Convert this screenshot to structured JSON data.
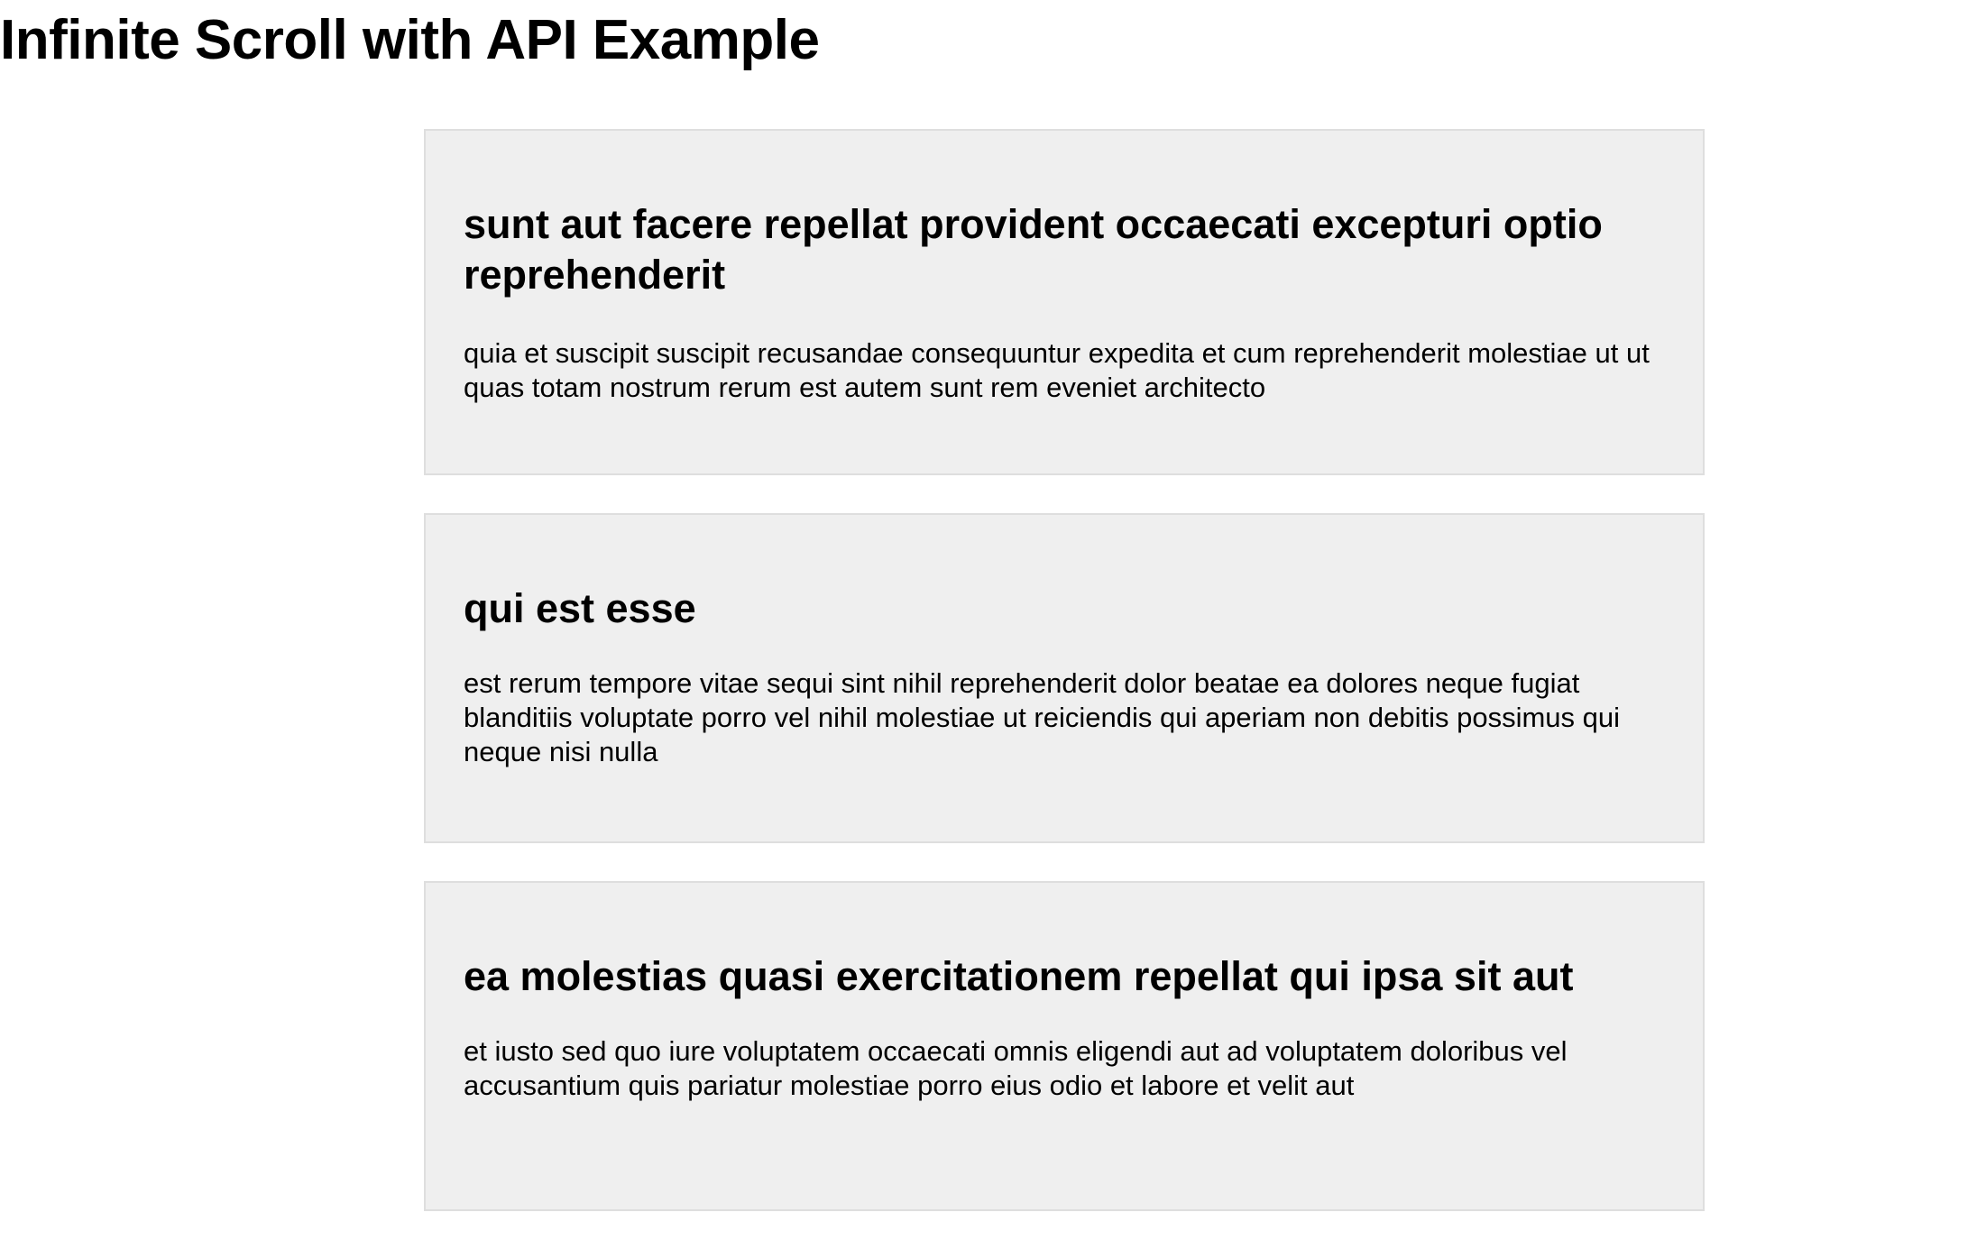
{
  "page": {
    "title": "Infinite Scroll with API Example"
  },
  "posts": [
    {
      "title": "sunt aut facere repellat provident occaecati excepturi optio reprehenderit",
      "body": "quia et suscipit suscipit recusandae consequuntur expedita et cum reprehenderit molestiae ut ut quas totam nostrum rerum est autem sunt rem eveniet architecto"
    },
    {
      "title": "qui est esse",
      "body": "est rerum tempore vitae sequi sint nihil reprehenderit dolor beatae ea dolores neque fugiat blanditiis voluptate porro vel nihil molestiae ut reiciendis qui aperiam non debitis possimus qui neque nisi nulla"
    },
    {
      "title": "ea molestias quasi exercitationem repellat qui ipsa sit aut",
      "body": "et iusto sed quo iure voluptatem occaecati omnis eligendi aut ad voluptatem doloribus vel accusantium quis pariatur molestiae porro eius odio et labore et velit aut"
    }
  ],
  "colors": {
    "card_background": "#efefef",
    "card_border": "#dedede",
    "text": "#000000",
    "page_background": "#ffffff"
  }
}
